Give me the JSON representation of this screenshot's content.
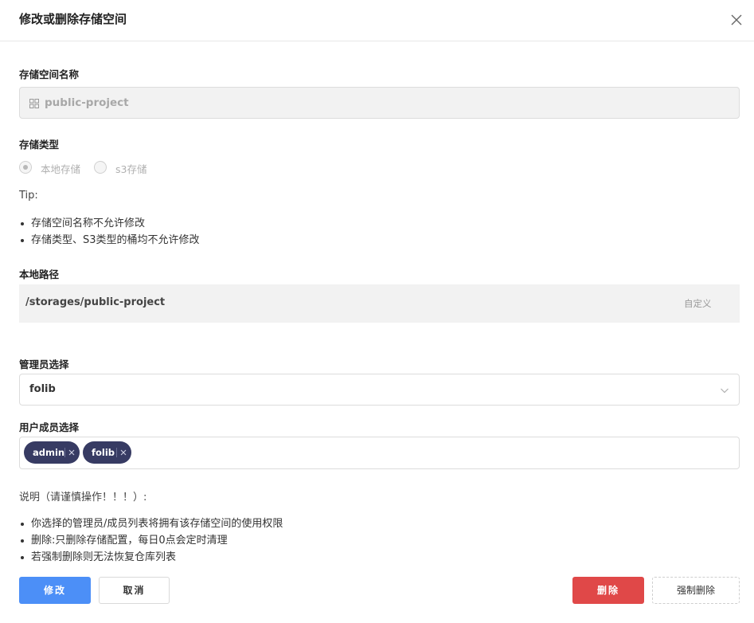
{
  "dialog": {
    "title": "修改或删除存储空间"
  },
  "storage_name": {
    "label": "存储空间名称",
    "value": "public-project",
    "icon": "grid-icon"
  },
  "storage_type": {
    "label": "存储类型",
    "options": [
      {
        "label": "本地存储",
        "selected": true
      },
      {
        "label": "s3存储",
        "selected": false
      }
    ]
  },
  "tip": {
    "heading": "Tip:",
    "items": [
      "存储空间名称不允许修改",
      "存储类型、S3类型的桶均不允许修改"
    ]
  },
  "local_path": {
    "label": "本地路径",
    "value": "/storages/public-project",
    "custom_label": "自定义"
  },
  "admin_select": {
    "label": "管理员选择",
    "value": "folib"
  },
  "member_select": {
    "label": "用户成员选择",
    "tags": [
      "admin",
      "folib"
    ]
  },
  "notes": {
    "heading": "说明（请谨慎操作！！！）:",
    "items": [
      "你选择的管理员/成员列表将拥有该存储空间的使用权限",
      "删除:只删除存储配置，每日0点会定时清理",
      "若强制删除则无法恢复仓库列表"
    ]
  },
  "buttons": {
    "modify": "修改",
    "cancel": "取消",
    "delete": "删除",
    "force_delete": "强制删除"
  },
  "colors": {
    "primary": "#4c8ff7",
    "danger": "#e04848",
    "tag": "#373b63"
  }
}
